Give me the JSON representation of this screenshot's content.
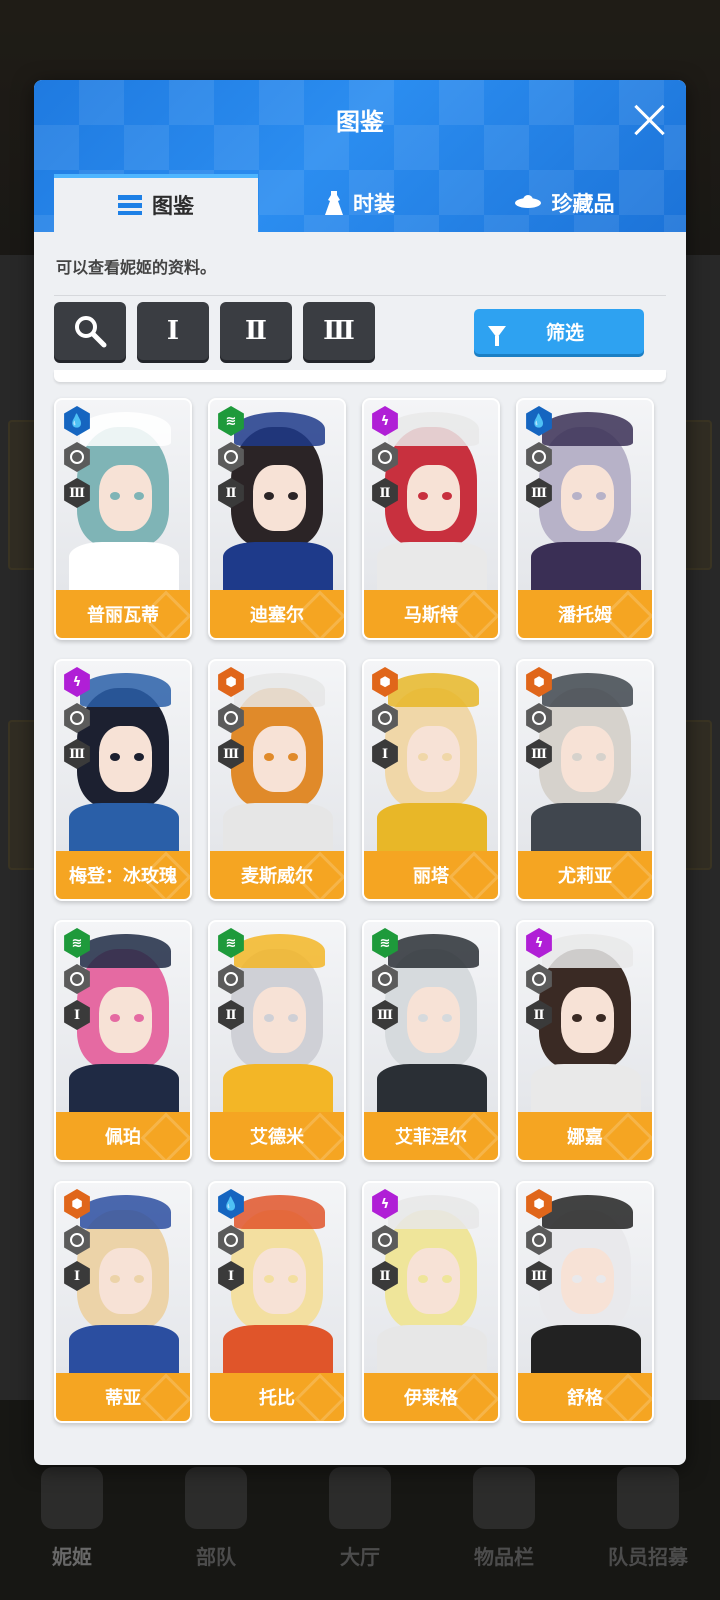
{
  "modal": {
    "title": "图鉴",
    "description": "可以查看妮姬的资料。",
    "tabs": [
      {
        "label": "图鉴",
        "icon": "list-icon",
        "active": true
      },
      {
        "label": "时装",
        "icon": "dress-icon",
        "active": false
      },
      {
        "label": "珍藏品",
        "icon": "treasure-icon",
        "active": false
      }
    ],
    "toolbar": {
      "search_icon": "search-icon",
      "burst_filters": [
        "Ⅰ",
        "Ⅱ",
        "Ⅲ"
      ],
      "filter_label": "筛选"
    }
  },
  "characters": [
    {
      "name": "普丽瓦蒂",
      "code": "water",
      "burst": "Ⅲ",
      "hair": "#7fb4b6",
      "accent": "#ffffff"
    },
    {
      "name": "迪塞尔",
      "code": "wind",
      "burst": "Ⅱ",
      "hair": "#2b2426",
      "accent": "#1e3a8a"
    },
    {
      "name": "马斯特",
      "code": "electric",
      "burst": "Ⅱ",
      "hair": "#c8303e",
      "accent": "#e9e9e9"
    },
    {
      "name": "潘托姆",
      "code": "water",
      "burst": "Ⅲ",
      "hair": "#b7b2c8",
      "accent": "#3a2f55"
    },
    {
      "name": "梅登：冰玫瑰",
      "code": "electric",
      "burst": "Ⅲ",
      "hair": "#1c2030",
      "accent": "#2a5fa8"
    },
    {
      "name": "麦斯威尔",
      "code": "fire",
      "burst": "Ⅲ",
      "hair": "#e08a2a",
      "accent": "#e6e6e6"
    },
    {
      "name": "丽塔",
      "code": "fire",
      "burst": "Ⅰ",
      "hair": "#f0d7a8",
      "accent": "#e8b728"
    },
    {
      "name": "尤莉亚",
      "code": "fire",
      "burst": "Ⅲ",
      "hair": "#d6d2cc",
      "accent": "#40464e"
    },
    {
      "name": "佩珀",
      "code": "wind",
      "burst": "Ⅰ",
      "hair": "#e56aa2",
      "accent": "#1f2a44"
    },
    {
      "name": "艾德米",
      "code": "wind",
      "burst": "Ⅱ",
      "hair": "#cfd0d6",
      "accent": "#f3b626"
    },
    {
      "name": "艾菲涅尔",
      "code": "wind",
      "burst": "Ⅲ",
      "hair": "#d6dadd",
      "accent": "#2a2f35"
    },
    {
      "name": "娜嘉",
      "code": "electric",
      "burst": "Ⅱ",
      "hair": "#3a2a24",
      "accent": "#e9e9e9"
    },
    {
      "name": "蒂亚",
      "code": "fire",
      "burst": "Ⅰ",
      "hair": "#ecd3a8",
      "accent": "#2b4ea0"
    },
    {
      "name": "托比",
      "code": "water",
      "burst": "Ⅰ",
      "hair": "#f3dfa0",
      "accent": "#e0552a"
    },
    {
      "name": "伊莱格",
      "code": "electric",
      "burst": "Ⅱ",
      "hair": "#efe59a",
      "accent": "#e7e7e7"
    },
    {
      "name": "舒格",
      "code": "fire",
      "burst": "Ⅲ",
      "hair": "#e9e9ec",
      "accent": "#222222"
    }
  ],
  "code_colors": {
    "water": "#1565c0",
    "wind": "#1e9a3b",
    "electric": "#b01fd6",
    "fire": "#e0661a"
  },
  "bottom_nav": [
    {
      "label": "妮姬",
      "active": true
    },
    {
      "label": "部队",
      "active": false
    },
    {
      "label": "大厅",
      "active": false
    },
    {
      "label": "物品栏",
      "active": false
    },
    {
      "label": "队员招募",
      "active": false
    }
  ]
}
